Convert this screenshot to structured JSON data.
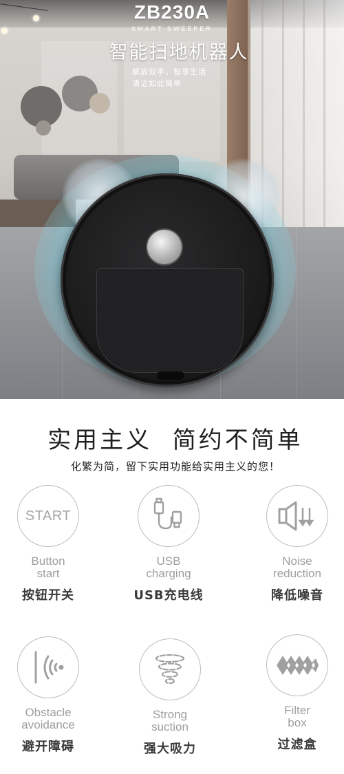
{
  "hero": {
    "model": "ZB230A",
    "subtitle_en": "SMART SWEEPER",
    "title_cn": "智能扫地机器人",
    "tagline_lines": [
      "解放双手，智享生活",
      "清洁如此简单"
    ]
  },
  "slogan": {
    "title": "实用主义  简约不简单",
    "subtitle": "化繁为简，留下实用功能给实用主义的您！"
  },
  "features": [
    {
      "icon": "start-icon",
      "icon_text": "START",
      "label_en": "Button\nstart",
      "label_cn": "按钮开关"
    },
    {
      "icon": "usb-cable-icon",
      "label_en": "USB\ncharging",
      "label_cn": "USB充电线"
    },
    {
      "icon": "speaker-mute-icon",
      "label_en": "Noise\nreduction",
      "label_cn": "降低噪音"
    },
    {
      "icon": "wave-sensor-icon",
      "label_en": "Obstacle\navoidance",
      "label_cn": "避开障碍"
    },
    {
      "icon": "cyclone-icon",
      "label_en": "Strong\nsuction",
      "label_cn": "强大吸力"
    },
    {
      "icon": "filter-mesh-icon",
      "label_en": "Filter\nbox",
      "label_cn": "过滤盒"
    }
  ]
}
